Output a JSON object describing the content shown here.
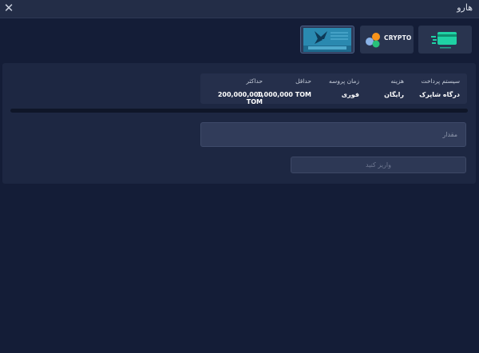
{
  "modal": {
    "title": "هارو",
    "close_icon": "close-icon"
  },
  "payment_methods": [
    {
      "id": "shaparak",
      "icon": "credit-card-icon",
      "selected": false
    },
    {
      "id": "crypto",
      "label": "CRYPTO",
      "icon": "crypto-coins-icon",
      "selected": false
    },
    {
      "id": "bank",
      "icon": "bank-logo-icon",
      "selected": true
    }
  ],
  "info": {
    "payment_system_label": "سیستم پرداخت",
    "payment_system_value": "درگاه شاپرک",
    "fee_label": "هزینه",
    "fee_value": "رایگان",
    "process_time_label": "زمان پروسه",
    "process_time_value": "فوری",
    "min_label": "حداقل",
    "min_value": "1,000,000 TOM",
    "max_label": "حداکثر",
    "max_value": "200,000,000 TOM"
  },
  "amount": {
    "placeholder": "مقدار",
    "value": ""
  },
  "deposit_button": {
    "label": "واریز کنید"
  },
  "colors": {
    "background": "#141d37",
    "panel": "#1d2742",
    "card_green": "#1fd1a4",
    "btc_orange": "#f7931a"
  }
}
